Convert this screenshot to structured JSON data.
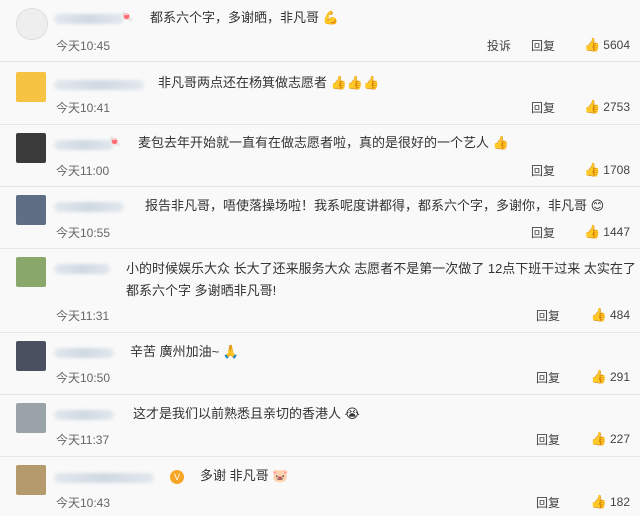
{
  "comments": [
    {
      "suffix": "",
      "text": "都系六个字，多谢晒，非凡哥",
      "emoji": "💪",
      "time": "今天10:45",
      "report": "投诉",
      "reply": "回复",
      "likes": "5604"
    },
    {
      "suffix": "",
      "text": "非凡哥两点还在杨箕做志愿者",
      "emoji": "👍👍👍",
      "time": "今天10:41",
      "reply": "回复",
      "likes": "2753"
    },
    {
      "suffix": "",
      "text": "麦包去年开始就一直有在做志愿者啦，真的是很好的一个艺人",
      "emoji": "👍",
      "time": "今天11:00",
      "reply": "回复",
      "likes": "1708"
    },
    {
      "suffix": "",
      "text": "报告非凡哥，唔使落操场啦！我系呢度讲都得，都系六个字，多谢你，非凡哥",
      "emoji": "😊",
      "time": "今天10:55",
      "reply": "回复",
      "likes": "1447"
    },
    {
      "suffix": "",
      "text": "小的时候娱乐大众 长大了还来服务大众 志愿者不是第一次做了 12点下班干过来 太实在了 都系六个字 多谢晒非凡哥!",
      "emoji": "",
      "time": "今天11:31",
      "reply": "回复",
      "likes": "484"
    },
    {
      "suffix": "",
      "text": "辛苦 廣州加油~",
      "emoji": "🙏",
      "time": "今天10:50",
      "reply": "回复",
      "likes": "291"
    },
    {
      "suffix": "",
      "text": "这才是我们以前熟悉且亲切的香港人",
      "emoji": "😭",
      "time": "今天11:37",
      "reply": "回复",
      "likes": "227"
    },
    {
      "suffix": "",
      "text": "多谢 非凡哥",
      "emoji": "🐷",
      "time": "今天10:43",
      "reply": "回复",
      "likes": "182"
    }
  ]
}
